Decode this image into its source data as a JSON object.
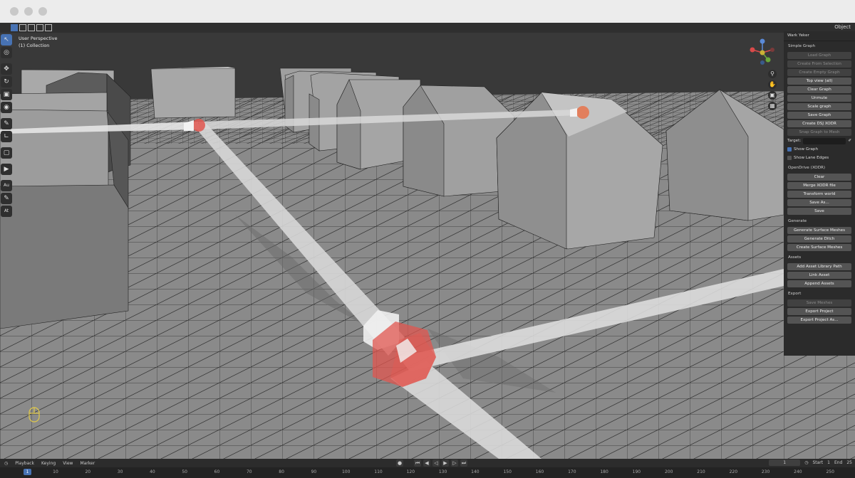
{
  "window": {
    "mode_label": "Object"
  },
  "viewport": {
    "title": "User Perspective",
    "collection": "(1) Collection"
  },
  "toolbar": {
    "a_label": "Au",
    "b_label": "At"
  },
  "panel": {
    "title": "Wark Yeker",
    "sections": [
      {
        "label": "Simple Graph",
        "items": [
          {
            "label": "Load Graph",
            "enabled": false
          },
          {
            "label": "Create From Selection",
            "enabled": false
          },
          {
            "label": "Create Empty Graph",
            "enabled": false
          },
          {
            "label": "Top view (all)",
            "enabled": true
          },
          {
            "label": "Clear Graph",
            "enabled": true
          },
          {
            "label": "Unmute",
            "enabled": true
          },
          {
            "label": "Scale graph",
            "enabled": true
          },
          {
            "label": "Save Graph",
            "enabled": true
          },
          {
            "label": "Create DSJ XODR",
            "enabled": true
          },
          {
            "label": "Snap Graph to Mesh",
            "enabled": false
          }
        ]
      },
      {
        "label": "OpenDrive (XODR)",
        "items": [
          {
            "label": "Clear",
            "enabled": true
          },
          {
            "label": "Merge XODR file",
            "enabled": true
          },
          {
            "label": "Transform world",
            "enabled": true
          },
          {
            "label": "Save As...",
            "enabled": true
          },
          {
            "label": "Save",
            "enabled": true
          }
        ]
      },
      {
        "label": "Generate",
        "items": [
          {
            "label": "Generate Surface Meshes",
            "enabled": true
          },
          {
            "label": "Generate Ditch",
            "enabled": true
          },
          {
            "label": "Create Surface Meshes",
            "enabled": true
          }
        ]
      },
      {
        "label": "Assets",
        "items": [
          {
            "label": "Add Asset Library Path",
            "enabled": true
          },
          {
            "label": "Link Asset",
            "enabled": true
          },
          {
            "label": "Append Assets",
            "enabled": true
          }
        ]
      },
      {
        "label": "Export",
        "items": [
          {
            "label": "Save Meshes",
            "enabled": false
          },
          {
            "label": "Export Project",
            "enabled": true
          },
          {
            "label": "Export Project As...",
            "enabled": true
          }
        ]
      }
    ],
    "target_label": "Target:",
    "show_graph": {
      "label": "Show Graph",
      "checked": true
    },
    "show_lane_edges": {
      "label": "Show Lane Edges",
      "checked": false
    }
  },
  "timeline": {
    "menus": [
      "Playback",
      "Keying",
      "View",
      "Marker"
    ],
    "current_frame": "1",
    "start_label": "Start",
    "start_value": "1",
    "end_label": "End",
    "end_value": "25",
    "ruler_marks": [
      "10",
      "20",
      "30",
      "40",
      "50",
      "60",
      "70",
      "80",
      "90",
      "100",
      "110",
      "120",
      "130",
      "140",
      "150",
      "160",
      "170",
      "180",
      "190",
      "200",
      "210",
      "220",
      "230",
      "240",
      "250"
    ],
    "ruler_start": "1"
  },
  "colors": {
    "accent": "#4772b3",
    "node": "#e0564f",
    "road": "#dcdcdc"
  }
}
